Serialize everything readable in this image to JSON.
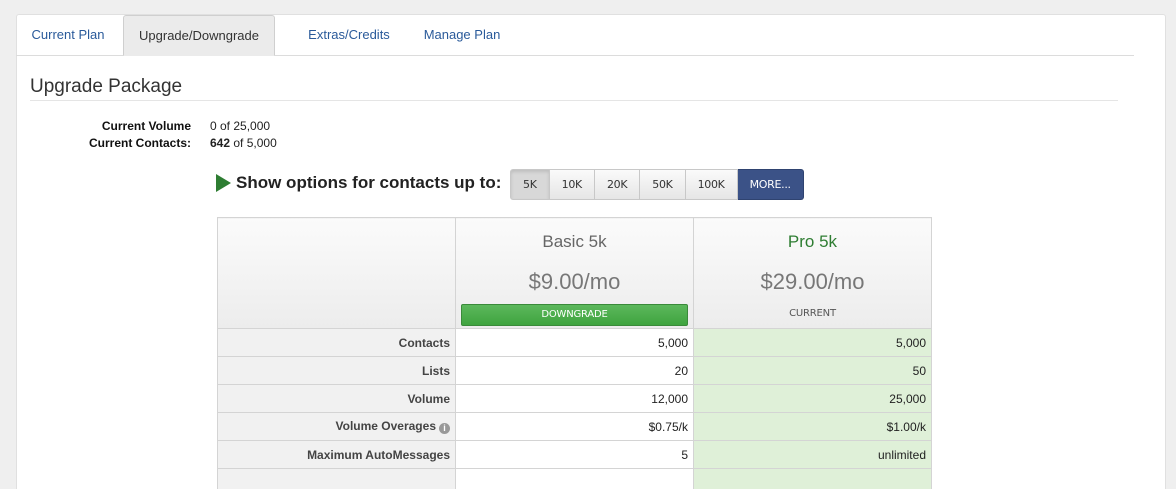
{
  "tabs": [
    {
      "label": "Current Plan",
      "active": false
    },
    {
      "label": "Upgrade/Downgrade",
      "active": true
    },
    {
      "label": "Extras/Credits",
      "active": false
    },
    {
      "label": "Manage Plan",
      "active": false
    }
  ],
  "section": {
    "title": "Upgrade Package"
  },
  "account_info": {
    "volume_label": "Current Volume",
    "volume_value": "0 of 25,000",
    "contacts_label": "Current Contacts:",
    "contacts_used": "642",
    "contacts_rest": " of 5,000"
  },
  "options": {
    "label": "Show options for contacts up to:",
    "buttons": [
      "5K",
      "10K",
      "20K",
      "50K",
      "100K",
      "MORE..."
    ],
    "selected": "5K"
  },
  "plans": {
    "basic": {
      "name": "Basic 5k",
      "price": "$9.00/mo",
      "action": "DOWNGRADE"
    },
    "pro": {
      "name": "Pro 5k",
      "price": "$29.00/mo",
      "status": "CURRENT"
    }
  },
  "features": [
    {
      "label": "Contacts",
      "basic": "5,000",
      "pro": "5,000",
      "info": false
    },
    {
      "label": "Lists",
      "basic": "20",
      "pro": "50",
      "info": false
    },
    {
      "label": "Volume",
      "basic": "12,000",
      "pro": "25,000",
      "info": false
    },
    {
      "label": "Volume Overages",
      "basic": "$0.75/k",
      "pro": "$1.00/k",
      "info": true
    },
    {
      "label": "Maximum AutoMessages",
      "basic": "5",
      "pro": "unlimited",
      "info": false
    }
  ],
  "colors": {
    "link": "#2a5a9a",
    "accent_green": "#2e7d32",
    "current_highlight": "#dff0d8",
    "more_button": "#3b5287"
  }
}
